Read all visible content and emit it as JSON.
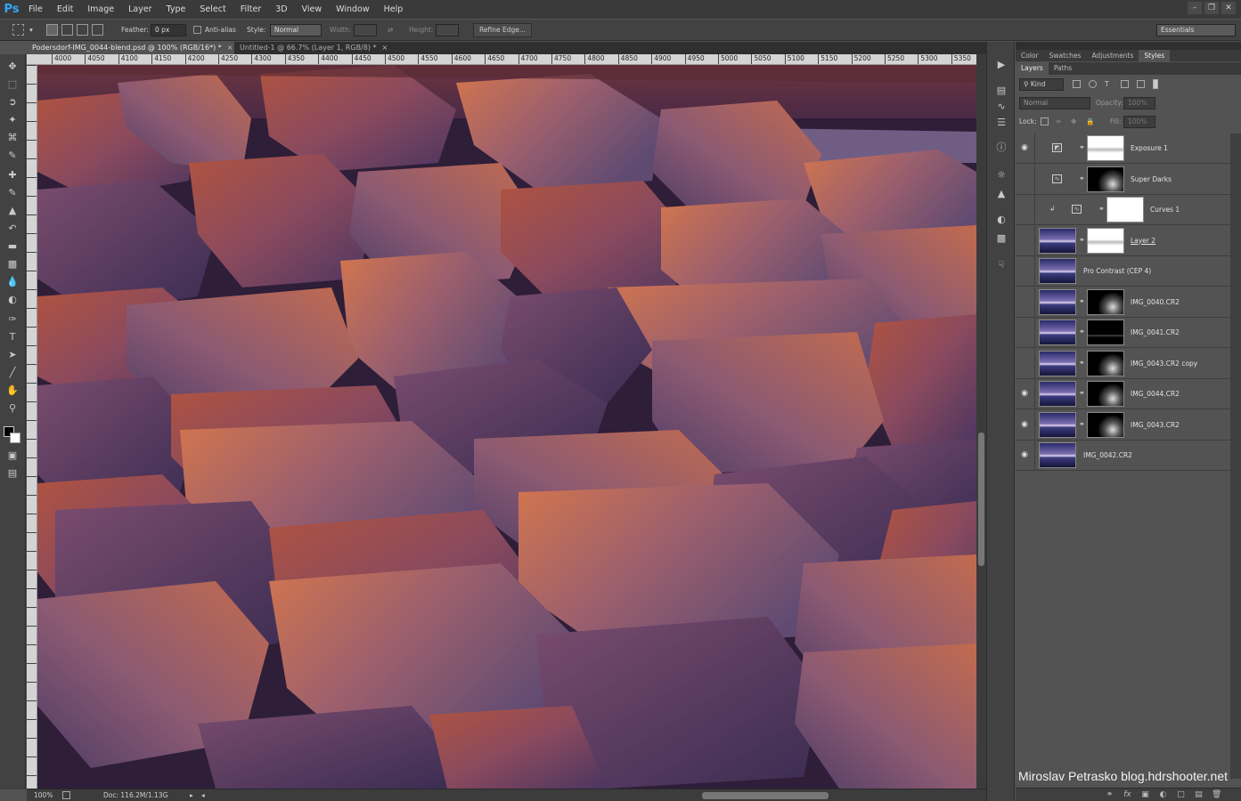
{
  "app": {
    "logo": "Ps"
  },
  "menu": [
    "File",
    "Edit",
    "Image",
    "Layer",
    "Type",
    "Select",
    "Filter",
    "3D",
    "View",
    "Window",
    "Help"
  ],
  "window_controls": [
    "minimize-icon",
    "restore-icon",
    "close-icon"
  ],
  "options": {
    "feather_label": "Feather:",
    "feather_value": "0 px",
    "antialias_label": "Anti-alias",
    "style_label": "Style:",
    "style_value": "Normal",
    "width_label": "Width:",
    "height_label": "Height:",
    "refine_edge": "Refine Edge...",
    "workspace": "Essentials"
  },
  "tabs": [
    {
      "label": "Podersdorf-IMG_0044-blend.psd @ 100% (RGB/16*) *",
      "active": true
    },
    {
      "label": "Untitled-1 @ 66.7% (Layer 1, RGB/8) *",
      "active": false
    }
  ],
  "ruler_ticks": [
    "4000",
    "4050",
    "4100",
    "4150",
    "4200",
    "4250",
    "4300",
    "4350",
    "4400",
    "4450",
    "4500",
    "4550",
    "4600",
    "4650",
    "4700",
    "4750",
    "4800",
    "4850",
    "4900",
    "4950",
    "5000",
    "5050",
    "5100",
    "5150",
    "5200",
    "5250",
    "5300",
    "5350"
  ],
  "status": {
    "zoom": "100%",
    "doc": "Doc: 116.2M/1.13G"
  },
  "panel_tabs_top": [
    "Color",
    "Swatches",
    "Adjustments",
    "Styles"
  ],
  "panel_tabs_layers": [
    "Layers",
    "Paths"
  ],
  "layers_panel": {
    "kind_label": "Kind",
    "blend_mode": "Normal",
    "opacity_label": "Opacity:",
    "opacity_value": "100%",
    "lock_label": "Lock:",
    "fill_label": "Fill:",
    "fill_value": "100%"
  },
  "layers": [
    {
      "name": "Exposure 1",
      "visible": true,
      "type": "adjustment",
      "icon": "exposure-icon",
      "mask": "white-mask"
    },
    {
      "name": "Super Darks",
      "visible": false,
      "type": "adjustment",
      "icon": "curves-icon",
      "mask": "dark-mask"
    },
    {
      "name": "Curves 1",
      "visible": false,
      "type": "adjustment",
      "icon": "curves-icon",
      "mask": "white",
      "clipped": true
    },
    {
      "name": "Layer 2",
      "visible": false,
      "type": "pixel",
      "mask": "white-mask",
      "underline": true
    },
    {
      "name": "Pro Contrast (CEP 4)",
      "visible": false,
      "type": "pixel",
      "mask": "none"
    },
    {
      "name": "IMG_0040.CR2",
      "visible": false,
      "type": "pixel",
      "mask": "dark-mask"
    },
    {
      "name": "IMG_0041.CR2",
      "visible": false,
      "type": "pixel",
      "mask": "black-mask"
    },
    {
      "name": "IMG_0043.CR2 copy",
      "visible": false,
      "type": "pixel",
      "mask": "dark-mask"
    },
    {
      "name": "IMG_0044.CR2",
      "visible": true,
      "type": "pixel",
      "mask": "dark-mask"
    },
    {
      "name": "IMG_0043.CR2",
      "visible": true,
      "type": "pixel",
      "mask": "dark-mask"
    },
    {
      "name": "IMG_0042.CR2",
      "visible": true,
      "type": "pixel",
      "mask": "none"
    }
  ],
  "watermark": "Miroslav  Petrasko  blog.hdrshooter.net",
  "colors": {
    "accent": "#31a8ff",
    "panel": "#535353",
    "dark": "#3a3a3a"
  }
}
